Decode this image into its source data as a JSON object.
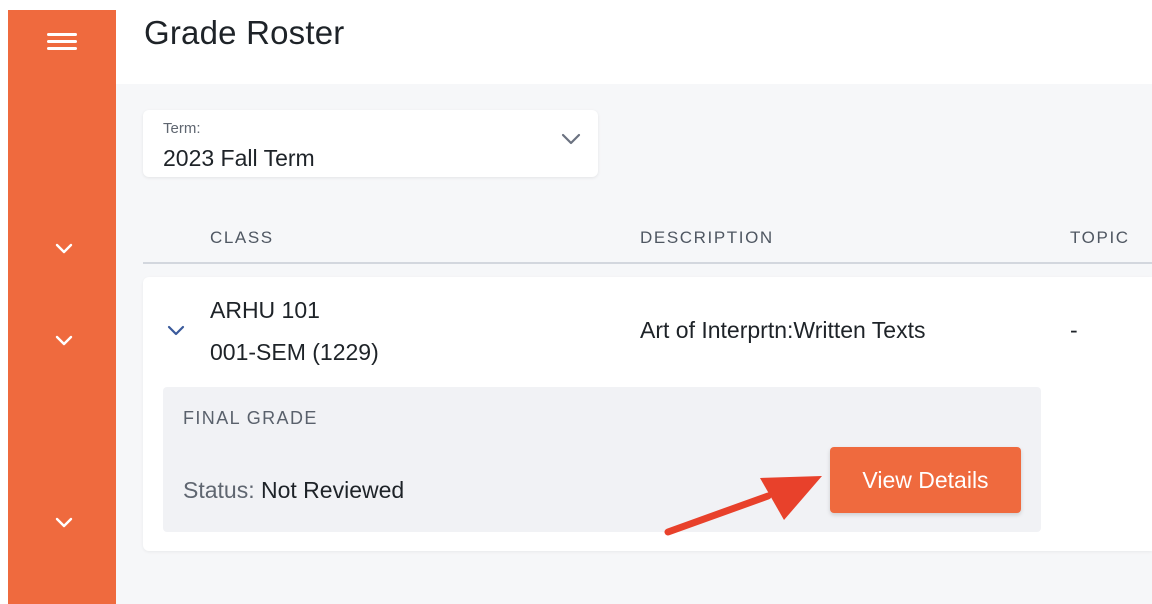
{
  "page": {
    "title": "Grade Roster"
  },
  "colors": {
    "accent": "#ef6a3e",
    "background": "#f6f7f9",
    "annotation_arrow": "#e8412b"
  },
  "sidebar": {
    "menu_icon": "hamburger-icon",
    "items": [
      {
        "icon": "chevron-down-icon"
      },
      {
        "icon": "chevron-down-icon"
      },
      {
        "icon": "chevron-down-icon"
      }
    ]
  },
  "term_select": {
    "label": "Term:",
    "value": "2023 Fall Term",
    "icon": "chevron-down-icon"
  },
  "table": {
    "columns": [
      "CLASS",
      "DESCRIPTION",
      "TOPIC"
    ],
    "rows": [
      {
        "class_code": "ARHU 101",
        "section": "001-SEM (1229)",
        "description": "Art of Interprtn:Written Texts",
        "topic": "-",
        "expanded": true,
        "final_grade": {
          "heading": "FINAL GRADE",
          "status_label": "Status:",
          "status_value": "Not Reviewed",
          "button_label": "View Details"
        }
      }
    ]
  }
}
